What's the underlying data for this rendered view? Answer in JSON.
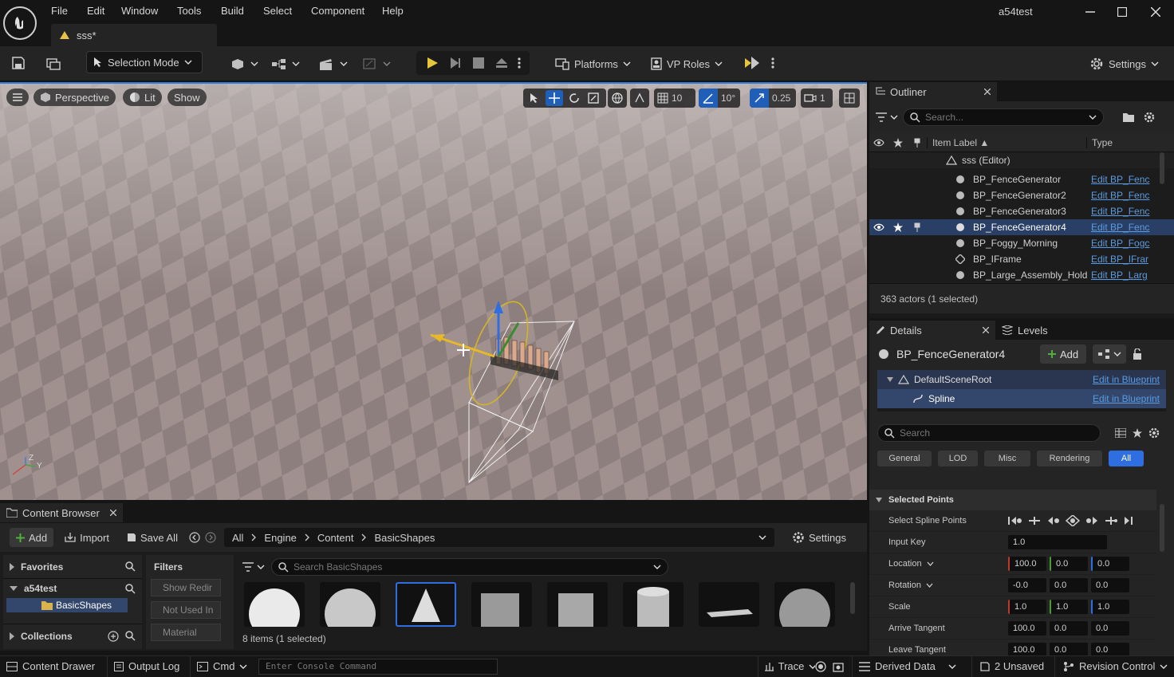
{
  "window": {
    "title": "a54test",
    "tab": "sss*"
  },
  "menu": [
    "File",
    "Edit",
    "Window",
    "Tools",
    "Build",
    "Select",
    "Component",
    "Help"
  ],
  "toolbar": {
    "selection_mode": "Selection Mode",
    "platforms": "Platforms",
    "vp_roles": "VP Roles",
    "settings": "Settings"
  },
  "viewport": {
    "perspective": "Perspective",
    "lit": "Lit",
    "show": "Show",
    "grid_snap": "10",
    "rot_snap": "10°",
    "scale_snap": "0.25",
    "camera_speed": "1",
    "axis_x": "Y",
    "axis_z": "Z"
  },
  "outliner": {
    "tab": "Outliner",
    "search_placeholder": "Search...",
    "col_label": "Item Label ▲",
    "col_type": "Type",
    "world": "sss (Editor)",
    "items": [
      {
        "label": "BP_FenceGenerator",
        "type": "Edit BP_Fenc"
      },
      {
        "label": "BP_FenceGenerator2",
        "type": "Edit BP_Fenc"
      },
      {
        "label": "BP_FenceGenerator3",
        "type": "Edit BP_Fenc"
      },
      {
        "label": "BP_FenceGenerator4",
        "type": "Edit BP_Fenc"
      },
      {
        "label": "BP_Foggy_Morning",
        "type": "Edit BP_Fogc"
      },
      {
        "label": "BP_IFrame",
        "type": "Edit BP_IFrar"
      },
      {
        "label": "BP_Large_Assembly_Hold",
        "type": "Edit BP_Larg"
      }
    ],
    "status": "363 actors (1 selected)"
  },
  "details": {
    "tab": "Details",
    "levels_tab": "Levels",
    "actor": "BP_FenceGenerator4",
    "add": "Add",
    "components": [
      {
        "label": "DefaultSceneRoot",
        "link": "Edit in Blueprint"
      },
      {
        "label": "Spline",
        "link": "Edit in Blueprint"
      }
    ],
    "search_placeholder": "Search",
    "filters": [
      "General",
      "LOD",
      "Misc",
      "Rendering",
      "All"
    ],
    "section": "Selected Points",
    "props": {
      "select_points": "Select Spline Points",
      "input_key": {
        "label": "Input Key",
        "value": "1.0"
      },
      "location": {
        "label": "Location",
        "values": [
          "100.0",
          "0.0",
          "0.0"
        ]
      },
      "rotation": {
        "label": "Rotation",
        "values": [
          "-0.0",
          "0.0",
          "0.0"
        ]
      },
      "scale": {
        "label": "Scale",
        "values": [
          "1.0",
          "1.0",
          "1.0"
        ]
      },
      "arrive": {
        "label": "Arrive Tangent",
        "values": [
          "100.0",
          "0.0",
          "0.0"
        ]
      },
      "leave": {
        "label": "Leave Tangent",
        "values": [
          "100.0",
          "0.0",
          "0.0"
        ]
      }
    }
  },
  "content_browser": {
    "tab": "Content Browser",
    "add": "Add",
    "import": "Import",
    "save_all": "Save All",
    "breadcrumb": [
      "All",
      "Engine",
      "Content",
      "BasicShapes"
    ],
    "settings": "Settings",
    "favorites": "Favorites",
    "project": "a54test",
    "folder": "BasicShapes",
    "collections": "Collections",
    "filters_title": "Filters",
    "filters": [
      "Show Redir",
      "Not Used In",
      "Material"
    ],
    "search_placeholder": "Search BasicShapes",
    "count": "8 items (1 selected)"
  },
  "statusbar": {
    "content_drawer": "Content Drawer",
    "output_log": "Output Log",
    "cmd": "Cmd",
    "console_placeholder": "Enter Console Command",
    "trace": "Trace",
    "derived_data": "Derived Data",
    "unsaved": "2 Unsaved",
    "revision": "Revision Control"
  }
}
